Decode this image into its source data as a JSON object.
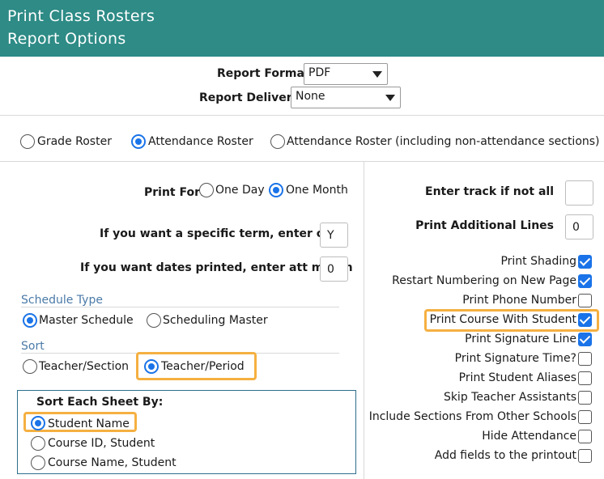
{
  "header": {
    "title": "Print Class Rosters",
    "subtitle": "Report Options"
  },
  "report": {
    "format_label": "Report Format:",
    "format_value": "PDF",
    "delivery_label": "Report Delivery:",
    "delivery_value": "None"
  },
  "roster_types": [
    {
      "label": "Grade Roster",
      "selected": false
    },
    {
      "label": "Attendance Roster",
      "selected": true
    },
    {
      "label": "Attendance Roster (including non-attendance sections)",
      "selected": false
    }
  ],
  "print_for": {
    "label": "Print For:",
    "options": [
      {
        "label": "One Day",
        "selected": false
      },
      {
        "label": "One Month",
        "selected": true
      }
    ]
  },
  "term": {
    "label": "If you want a specific term, enter code",
    "value": "Y"
  },
  "att_month": {
    "label": "If you want dates printed, enter att month",
    "value": "0"
  },
  "schedule_type": {
    "title": "Schedule Type",
    "options": [
      {
        "label": "Master Schedule",
        "selected": true
      },
      {
        "label": "Scheduling Master",
        "selected": false
      }
    ]
  },
  "sort": {
    "title": "Sort",
    "options": [
      {
        "label": "Teacher/Section",
        "selected": false
      },
      {
        "label": "Teacher/Period",
        "selected": true
      }
    ]
  },
  "sort_each_sheet": {
    "title": "Sort Each Sheet By:",
    "options": [
      {
        "label": "Student Name",
        "selected": true
      },
      {
        "label": "Course ID, Student",
        "selected": false
      },
      {
        "label": "Course Name, Student",
        "selected": false
      }
    ]
  },
  "track": {
    "label": "Enter track if not all",
    "value": ""
  },
  "additional_lines": {
    "label": "Print Additional Lines",
    "value": "0"
  },
  "checkboxes": [
    {
      "label": "Print Shading",
      "checked": true
    },
    {
      "label": "Restart Numbering on New Page",
      "checked": true
    },
    {
      "label": "Print Phone Number",
      "checked": false
    },
    {
      "label": "Print Course With Student",
      "checked": true
    },
    {
      "label": "Print Signature Line",
      "checked": true
    },
    {
      "label": "Print Signature Time?",
      "checked": false
    },
    {
      "label": "Print Student Aliases",
      "checked": false
    },
    {
      "label": "Skip Teacher Assistants",
      "checked": false
    },
    {
      "label": "Include Sections From Other Schools",
      "checked": false
    },
    {
      "label": "Hide Attendance",
      "checked": false
    },
    {
      "label": "Add fields to the printout",
      "checked": false
    }
  ],
  "colors": {
    "header_bg": "#2e8b86",
    "accent": "#1a73e8",
    "highlight": "#f5b041",
    "section_title": "#4a7aa8"
  }
}
